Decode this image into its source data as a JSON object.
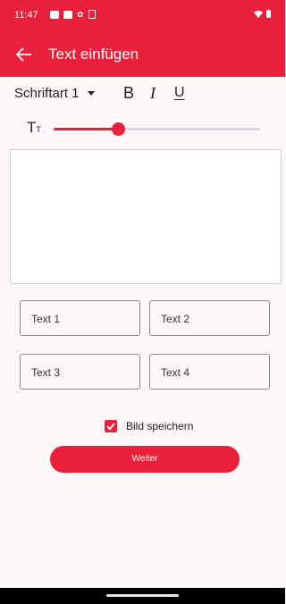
{
  "status_bar": {
    "time": "11:47"
  },
  "app_bar": {
    "title": "Text einfügen"
  },
  "toolbar": {
    "font": "Schriftart 1",
    "bold": "B",
    "italic": "I",
    "underline": "U"
  },
  "size_slider": {
    "value_fraction": 0.31
  },
  "text_buttons": [
    "Text 1",
    "Text 2",
    "Text 3",
    "Text 4"
  ],
  "save_option": {
    "label": "Bild speichern",
    "checked": true
  },
  "next_button": {
    "label": "Weiter"
  },
  "colors": {
    "accent": "#e8203c",
    "background": "#fdf7f8"
  }
}
